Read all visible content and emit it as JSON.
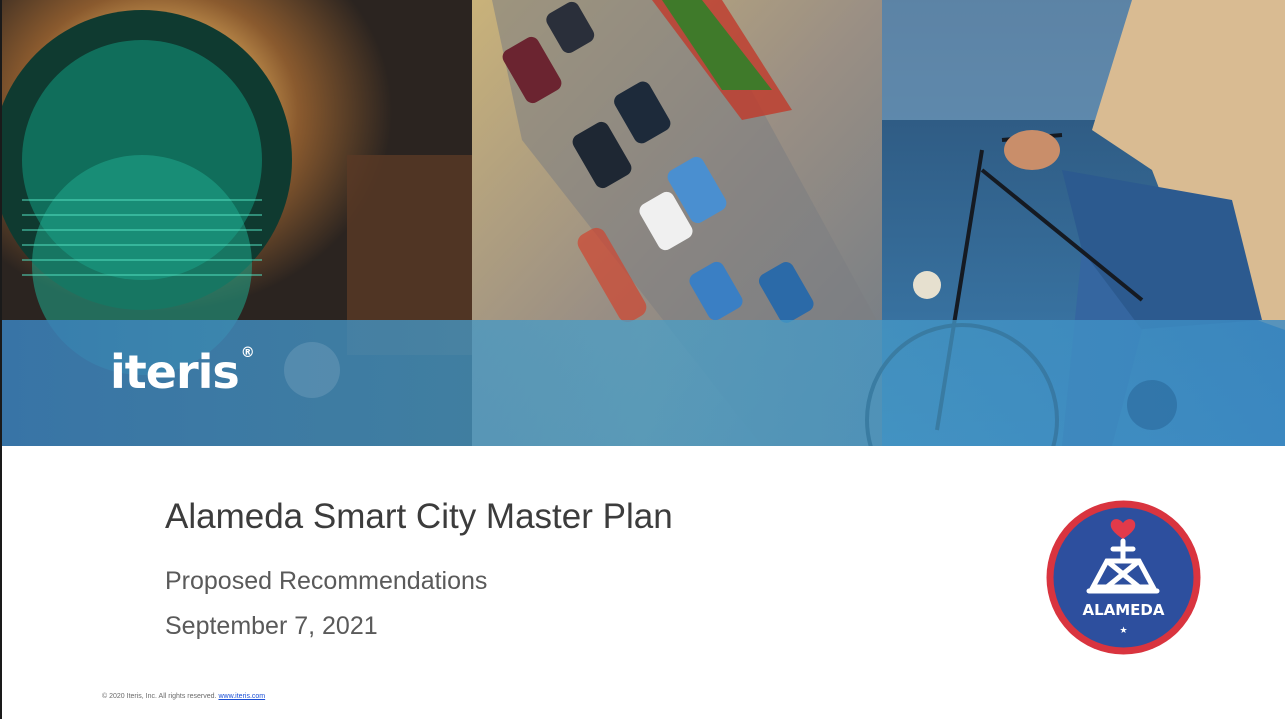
{
  "brand": {
    "logo_text": "iteris",
    "trademark": "®"
  },
  "title": "Alameda Smart City Master Plan",
  "subtitle": "Proposed Recommendations",
  "date": "September 7, 2021",
  "footer": {
    "copyright": "© 2020 Iteris, Inc.  All rights reserved.",
    "link_text": "www.iteris.com"
  },
  "seal": {
    "text": "ALAMEDA",
    "ring_color": "#d9343f",
    "fill_color": "#2d4f9e"
  },
  "colors": {
    "banner_blue": "#3a8fc9",
    "title_gray": "#3c3c3c",
    "subtitle_gray": "#5a5a5a"
  }
}
